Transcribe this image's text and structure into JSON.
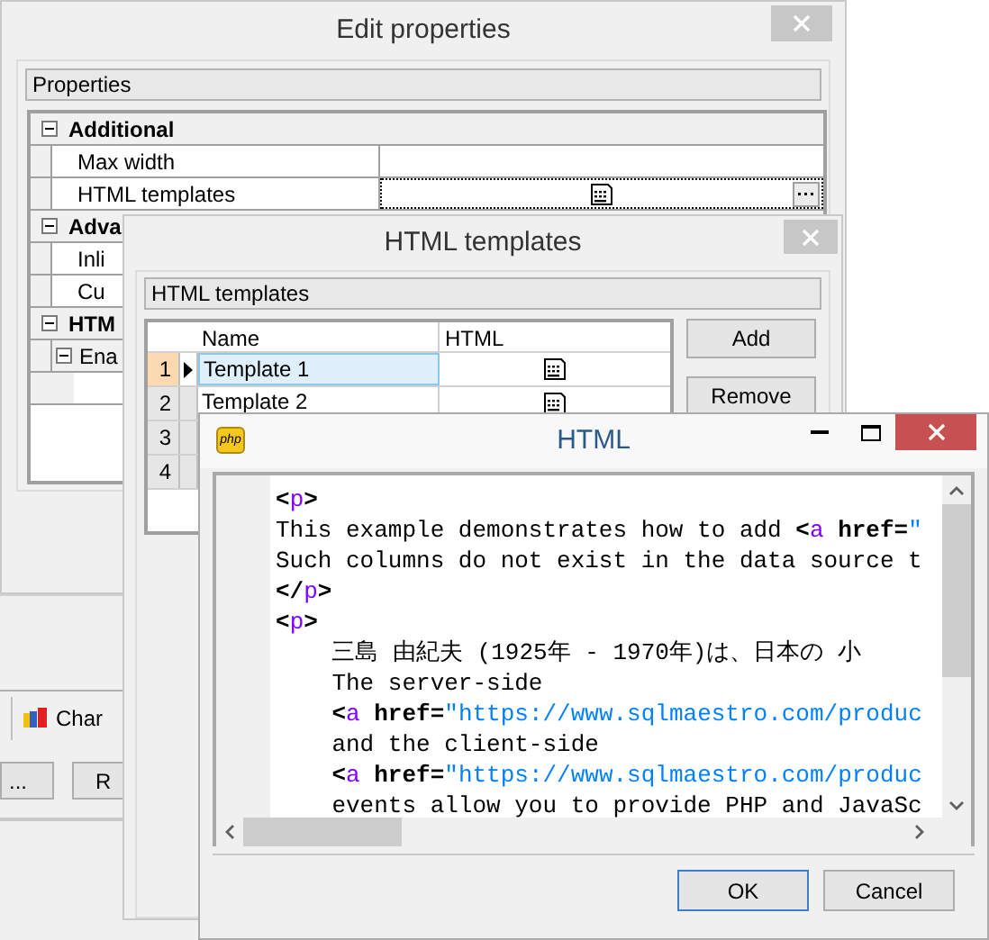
{
  "back_window": {
    "tab": "Char",
    "buttons": [
      "...",
      "R"
    ]
  },
  "edit_properties": {
    "title": "Edit properties",
    "group": "Properties",
    "categories": [
      {
        "label": "Additional",
        "expanded": true,
        "rows": [
          {
            "name": "Max width",
            "selected": false,
            "kind": "text"
          },
          {
            "name": "HTML templates",
            "selected": true,
            "kind": "html"
          }
        ]
      },
      {
        "label": "Adva",
        "expanded": true,
        "rows": [
          {
            "name": "Inli",
            "selected": false,
            "kind": "text"
          },
          {
            "name": "Cu",
            "selected": false,
            "kind": "text"
          }
        ]
      },
      {
        "label": "HTM",
        "expanded": true,
        "rows": [
          {
            "name": "Ena",
            "selected": false,
            "kind": "group",
            "expanded": true
          }
        ]
      }
    ]
  },
  "html_templates": {
    "title": "HTML templates",
    "group": "HTML templates",
    "columns": [
      "Name",
      "HTML"
    ],
    "rows": [
      {
        "number": "1",
        "name": "Template 1",
        "selected": true,
        "html": true
      },
      {
        "number": "2",
        "name": "Template 2",
        "selected": false,
        "html": true
      },
      {
        "number": "3",
        "selected": false
      },
      {
        "number": "4",
        "selected": false
      }
    ],
    "buttons": [
      "Add",
      "Remove"
    ]
  },
  "html_editor": {
    "title": "HTML",
    "app_icon_label": "php",
    "lines": [
      [
        {
          "kind": "punct",
          "text": "<"
        },
        {
          "kind": "tag",
          "text": "p"
        },
        {
          "kind": "punct",
          "text": ">"
        }
      ],
      [
        {
          "kind": "text",
          "text": "This example demonstrates how to add "
        },
        {
          "kind": "punct",
          "text": "<"
        },
        {
          "kind": "tag",
          "text": "a"
        },
        {
          "kind": "attr",
          "text": " href="
        },
        {
          "kind": "string",
          "text": "\""
        }
      ],
      [
        {
          "kind": "text",
          "text": "Such columns do not exist in the data source t"
        }
      ],
      [
        {
          "kind": "punct",
          "text": "</"
        },
        {
          "kind": "tag",
          "text": "p"
        },
        {
          "kind": "punct",
          "text": ">"
        }
      ],
      [
        {
          "kind": "punct",
          "text": "<"
        },
        {
          "kind": "tag",
          "text": "p"
        },
        {
          "kind": "punct",
          "text": ">"
        }
      ],
      [
        {
          "kind": "text",
          "text": "    三島 由紀夫 (1925年 - 1970年)は、日本の 小"
        }
      ],
      [
        {
          "kind": "text",
          "text": "    The server-side"
        }
      ],
      [
        {
          "kind": "punct",
          "text": "    <"
        },
        {
          "kind": "tag",
          "text": "a"
        },
        {
          "kind": "attr",
          "text": " href="
        },
        {
          "kind": "string",
          "text": "\"https://www.sqlmaestro.com/produc"
        }
      ],
      [
        {
          "kind": "text",
          "text": "    and the client-side"
        }
      ],
      [
        {
          "kind": "punct",
          "text": "    <"
        },
        {
          "kind": "tag",
          "text": "a"
        },
        {
          "kind": "attr",
          "text": " href="
        },
        {
          "kind": "string",
          "text": "\"https://www.sqlmaestro.com/produc"
        }
      ],
      [
        {
          "kind": "text",
          "text": "    events allow you to provide PHP and JavaSc"
        }
      ]
    ],
    "buttons": [
      {
        "label": "OK",
        "default": true
      },
      {
        "label": "Cancel",
        "default": false
      }
    ]
  }
}
